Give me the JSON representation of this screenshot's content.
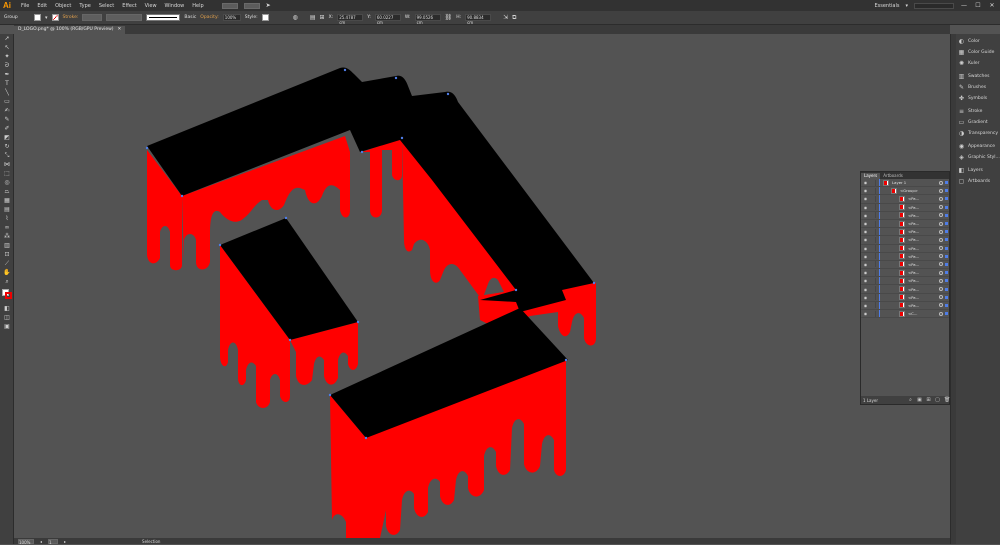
{
  "app": {
    "logo": "Ai"
  },
  "menu": [
    "File",
    "Edit",
    "Object",
    "Type",
    "Select",
    "Effect",
    "View",
    "Window",
    "Help"
  ],
  "workspace": {
    "label": "Essentials",
    "window_buttons": [
      "—",
      "☐",
      "✕"
    ]
  },
  "control_bar": {
    "selection_label": "Group",
    "stroke_label": "Stroke:",
    "brush_label": "Basic",
    "opacity_label": "Opacity:",
    "opacity_value": "100%",
    "style_label": "Style:",
    "x_value": "25.4787 cm",
    "y_value": "60.0227 cm",
    "w_value": "99.0526 cm",
    "h_value": "90.8834 cm"
  },
  "document": {
    "tab_title": "D_LOGO.png* @ 100% (RGB/GPU Preview)",
    "close": "✕"
  },
  "status": {
    "zoom": "100%",
    "artboard": "1",
    "mode": "Selection"
  },
  "colors": {
    "fill": "#ff0000",
    "top": "#000000",
    "anchor": "#4f7de8",
    "canvas": "#535353"
  },
  "panels": [
    {
      "icon": "color-icon",
      "glyph": "◐",
      "label": "Color"
    },
    {
      "icon": "color-guide-icon",
      "glyph": "▦",
      "label": "Color Guide"
    },
    {
      "icon": "kuler-icon",
      "glyph": "✺",
      "label": "Kuler"
    },
    {
      "icon": "swatches-icon",
      "glyph": "▥",
      "label": "Swatches"
    },
    {
      "icon": "brushes-icon",
      "glyph": "✎",
      "label": "Brushes"
    },
    {
      "icon": "symbols-icon",
      "glyph": "✤",
      "label": "Symbols"
    },
    {
      "icon": "stroke-icon",
      "glyph": "≡",
      "label": "Stroke"
    },
    {
      "icon": "gradient-icon",
      "glyph": "▭",
      "label": "Gradient"
    },
    {
      "icon": "transparency-icon",
      "glyph": "◑",
      "label": "Transparency"
    },
    {
      "icon": "appearance-icon",
      "glyph": "◉",
      "label": "Appearance"
    },
    {
      "icon": "graphic-styles-icon",
      "glyph": "◈",
      "label": "Graphic Styl..."
    },
    {
      "icon": "layers-icon",
      "glyph": "◧",
      "label": "Layers"
    },
    {
      "icon": "artboards-icon",
      "glyph": "▢",
      "label": "Artboards"
    }
  ],
  "layers_panel": {
    "tabs": [
      "Layers",
      "Artboards"
    ],
    "layer_name": "Layer 1",
    "group_name": "<Group>",
    "path_rows": [
      "<Pa...",
      "<Pa...",
      "<Pa...",
      "<Pa...",
      "<Pa...",
      "<Pa...",
      "<Pa...",
      "<Pa...",
      "<Pa...",
      "<Pa...",
      "<Pa...",
      "<Pa...",
      "<Pa...",
      "<Pa..."
    ],
    "last_row": "<C...",
    "footer": "1 Layer"
  },
  "tools": [
    "selection-icon",
    "direct-selection-icon",
    "magic-wand-icon",
    "lasso-icon",
    "pen-icon",
    "type-icon",
    "line-icon",
    "rectangle-icon",
    "paintbrush-icon",
    "pencil-icon",
    "blob-brush-icon",
    "eraser-icon",
    "rotate-icon",
    "scale-icon",
    "width-icon",
    "free-transform-icon",
    "shape-builder-icon",
    "perspective-icon",
    "mesh-icon",
    "gradient-tool-icon",
    "eyedropper-icon",
    "blend-icon",
    "symbol-sprayer-icon",
    "column-graph-icon",
    "artboard-icon",
    "slice-icon",
    "hand-icon",
    "zoom-icon"
  ]
}
